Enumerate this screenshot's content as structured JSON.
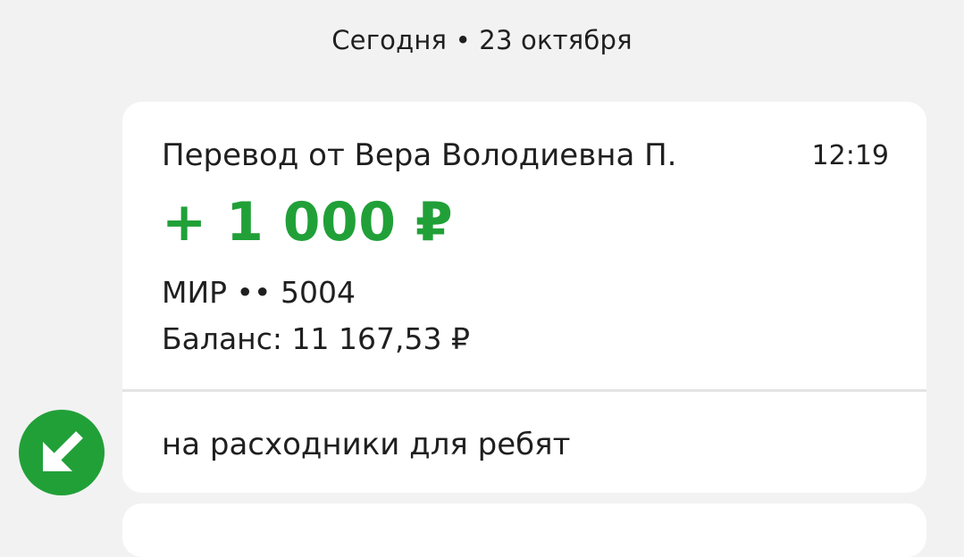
{
  "date_header": "Сегодня • 23 октября",
  "transaction": {
    "title": "Перевод от Вера Володиевна П.",
    "time": "12:19",
    "amount": "+ 1 000 ₽",
    "card": "МИР •• 5004",
    "balance": "Баланс: 11 167,53 ₽",
    "comment": "на расходники для ребят",
    "direction_icon": "incoming-arrow-icon"
  },
  "colors": {
    "accent_green": "#21a038",
    "background": "#f2f2f2",
    "card": "#ffffff"
  }
}
